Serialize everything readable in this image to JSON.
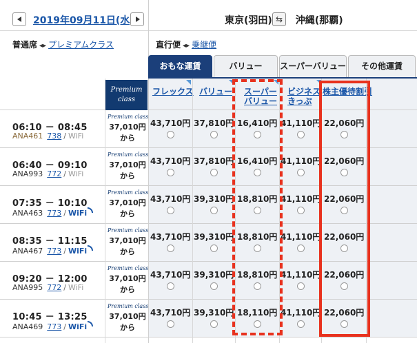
{
  "header": {
    "prev_icon": "triangle-left-icon",
    "next_icon": "triangle-right-icon",
    "date": "2019年09月11日(水)",
    "origin": "東京(羽田)",
    "swap_icon": "swap-arrows-icon",
    "swap_glyph": "⇆",
    "destination": "沖縄(那覇)"
  },
  "options": {
    "seat_label": "普通席",
    "premium_link": "プレミアムクラス",
    "nonstop_label": "直行便",
    "connection_link": "乗継便",
    "dir_glyph": "◂▸"
  },
  "tabs": [
    {
      "label": "おもな運賃",
      "active": true
    },
    {
      "label": "バリュー",
      "active": false
    },
    {
      "label": "スーパーバリュー",
      "active": false
    },
    {
      "label": "その他運賃",
      "active": false
    }
  ],
  "premium_badge": {
    "line1": "Premium",
    "line2": "class"
  },
  "columns": [
    {
      "line1": "フレックス",
      "line2": ""
    },
    {
      "line1": "バリュー",
      "line2": ""
    },
    {
      "line1": "スーパー",
      "line2": "バリュー"
    },
    {
      "line1": "ビジネス",
      "line2": "きっぷ"
    },
    {
      "line1": "株主優待割引",
      "line2": ""
    }
  ],
  "flights": [
    {
      "time": "06:10 － 08:45",
      "flight_no": "ANA461",
      "flight_brown": true,
      "aircraft": "738",
      "wifi": "WiFi",
      "wifi_on": false,
      "premium_label": "Premium class",
      "premium_price": "37,010円",
      "premium_suffix": "から",
      "fares": [
        "43,710円",
        "37,810円",
        "16,410円",
        "41,110円",
        "22,060円"
      ]
    },
    {
      "time": "06:40 － 09:10",
      "flight_no": "ANA993",
      "flight_brown": false,
      "aircraft": "772",
      "wifi": "WiFi",
      "wifi_on": false,
      "premium_label": "Premium class",
      "premium_price": "37,010円",
      "premium_suffix": "から",
      "fares": [
        "43,710円",
        "37,810円",
        "16,410円",
        "41,110円",
        "22,060円"
      ]
    },
    {
      "time": "07:35 － 10:10",
      "flight_no": "ANA463",
      "flight_brown": false,
      "aircraft": "773",
      "wifi": "WiFi",
      "wifi_on": true,
      "premium_label": "Premium class",
      "premium_price": "37,010円",
      "premium_suffix": "から",
      "fares": [
        "43,710円",
        "39,310円",
        "18,810円",
        "41,110円",
        "22,060円"
      ]
    },
    {
      "time": "08:35 － 11:15",
      "flight_no": "ANA467",
      "flight_brown": false,
      "aircraft": "773",
      "wifi": "WiFi",
      "wifi_on": true,
      "premium_label": "Premium class",
      "premium_price": "37,010円",
      "premium_suffix": "から",
      "fares": [
        "43,710円",
        "39,310円",
        "18,810円",
        "41,110円",
        "22,060円"
      ]
    },
    {
      "time": "09:20 － 12:00",
      "flight_no": "ANA995",
      "flight_brown": false,
      "aircraft": "772",
      "wifi": "WiFi",
      "wifi_on": false,
      "premium_label": "Premium class",
      "premium_price": "37,010円",
      "premium_suffix": "から",
      "fares": [
        "43,710円",
        "39,310円",
        "18,810円",
        "41,110円",
        "22,060円"
      ]
    },
    {
      "time": "10:45 － 13:25",
      "flight_no": "ANA469",
      "flight_brown": false,
      "aircraft": "773",
      "wifi": "WiFi",
      "wifi_on": true,
      "premium_label": "Premium class",
      "premium_price": "37,010円",
      "premium_suffix": "から",
      "fares": [
        "43,710円",
        "39,310円",
        "18,110円",
        "41,110円",
        "22,060円"
      ]
    }
  ],
  "colors": {
    "accent_navy": "#1b3f7a",
    "link_blue": "#1a56a8",
    "highlight_red": "#e8321e",
    "fare_bg": "#eef1f5"
  }
}
